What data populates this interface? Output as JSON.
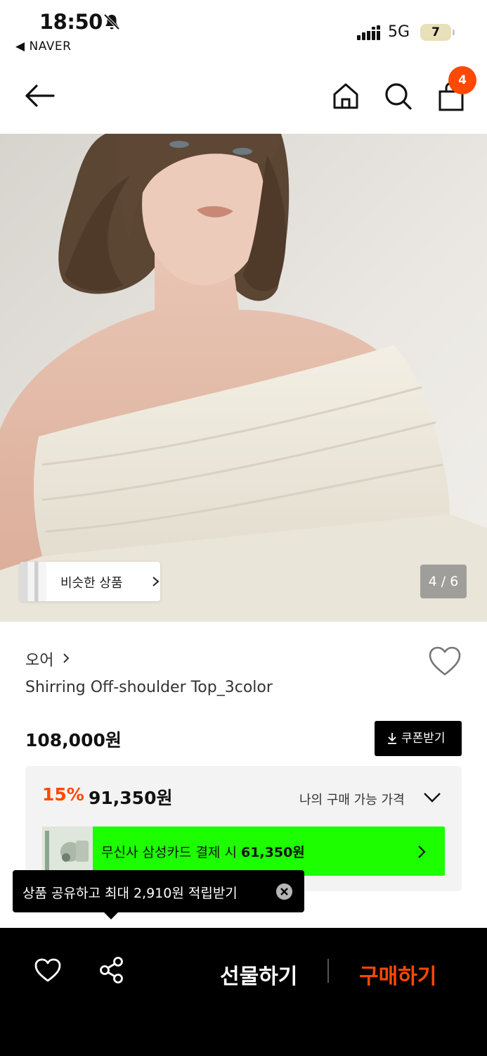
{
  "status_bar": {
    "time": "18:50",
    "back_app": "◀ NAVER",
    "network": "5G",
    "battery": "7"
  },
  "nav": {
    "cart_count": "4"
  },
  "hero": {
    "similar_label": "비슷한 상품",
    "page_counter": "4 / 6"
  },
  "product": {
    "brand": "오어",
    "name": "Shirring Off-shoulder Top_3color",
    "price_original": "108,000원",
    "coupon_label": "쿠폰받기",
    "discount_rate": "15%",
    "sale_price": "91,350원",
    "my_price_label": "나의 구매 가능 가격",
    "card_text_prefix": "무신사 삼성카드 결제 시 ",
    "card_price": "61,350원"
  },
  "tooltip": {
    "text": "상품 공유하고 최대 2,910원 적립받기"
  },
  "bottom_bar": {
    "gift_label": "선물하기",
    "buy_label": "구매하기"
  },
  "colors": {
    "accent": "#ff4800",
    "card_banner": "#1dfe00"
  }
}
